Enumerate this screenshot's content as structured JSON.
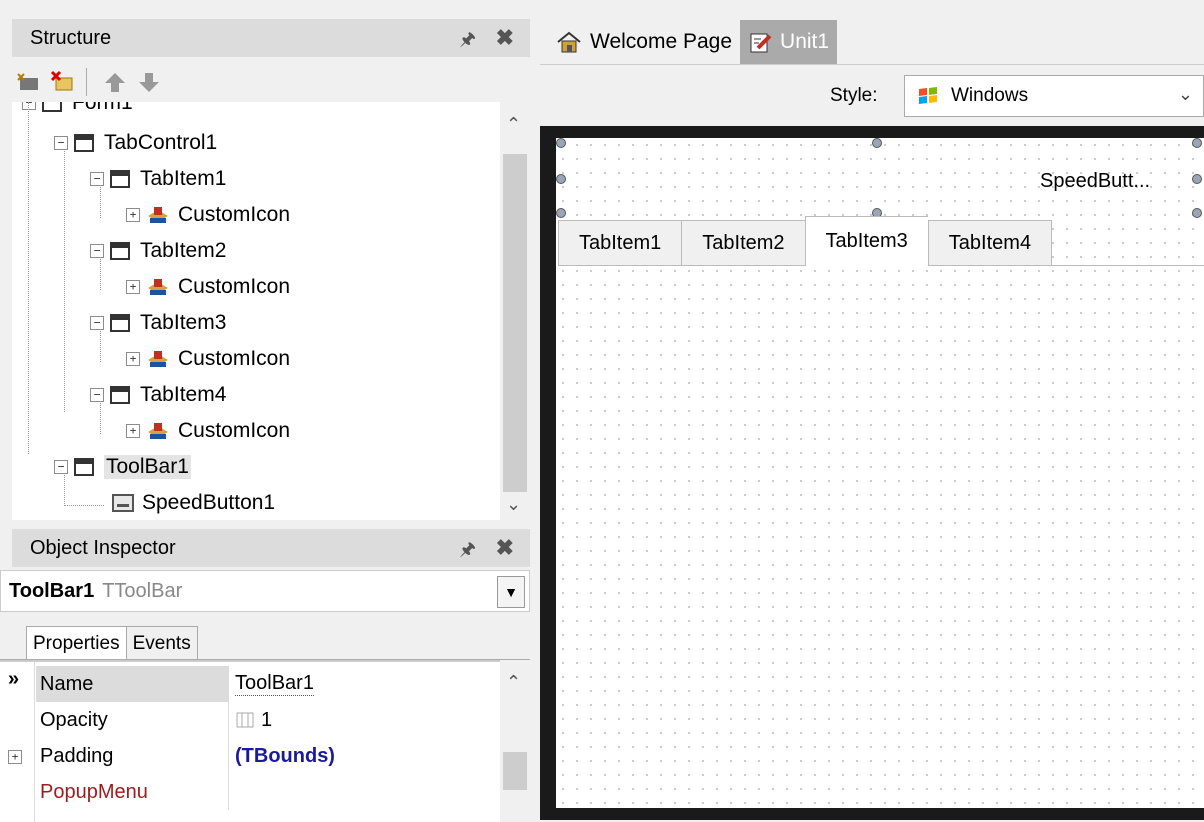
{
  "structure": {
    "title": "Structure",
    "pin": "⊥",
    "close": "✖",
    "partial_root": "Form1",
    "nodes": [
      {
        "label": "TabControl1"
      },
      {
        "label": "TabItem1"
      },
      {
        "label": "CustomIcon"
      },
      {
        "label": "TabItem2"
      },
      {
        "label": "CustomIcon"
      },
      {
        "label": "TabItem3"
      },
      {
        "label": "CustomIcon"
      },
      {
        "label": "TabItem4"
      },
      {
        "label": "CustomIcon"
      },
      {
        "label": "ToolBar1"
      },
      {
        "label": "SpeedButton1"
      }
    ],
    "toolbar_icons": [
      "new-item-icon",
      "delete-item-icon",
      "move-up-icon",
      "move-down-icon"
    ]
  },
  "object_inspector": {
    "title": "Object Inspector",
    "selected_name": "ToolBar1",
    "selected_type": "TToolBar",
    "tabs": [
      "Properties",
      "Events"
    ],
    "marker": "»",
    "properties": [
      {
        "name": "Name",
        "value": "ToolBar1"
      },
      {
        "name": "Opacity",
        "value": "1"
      },
      {
        "name": "Padding",
        "value": "(TBounds)"
      },
      {
        "name": "PopupMenu",
        "value": ""
      }
    ]
  },
  "document_tabs": [
    {
      "label": "Welcome Page",
      "icon": "home-icon"
    },
    {
      "label": "Unit1",
      "icon": "unit-file-icon"
    }
  ],
  "designer": {
    "style_label": "Style:",
    "style_value": "Windows",
    "speed_button_caption": "SpeedButt...",
    "form_tabs": [
      "TabItem1",
      "TabItem2",
      "TabItem3",
      "TabItem4"
    ],
    "active_form_tab": "TabItem3"
  },
  "colors": {
    "property_red": "#9b1c1c",
    "property_blue": "#1a1a9b",
    "active_doc_tab": "#aaaaaa"
  }
}
